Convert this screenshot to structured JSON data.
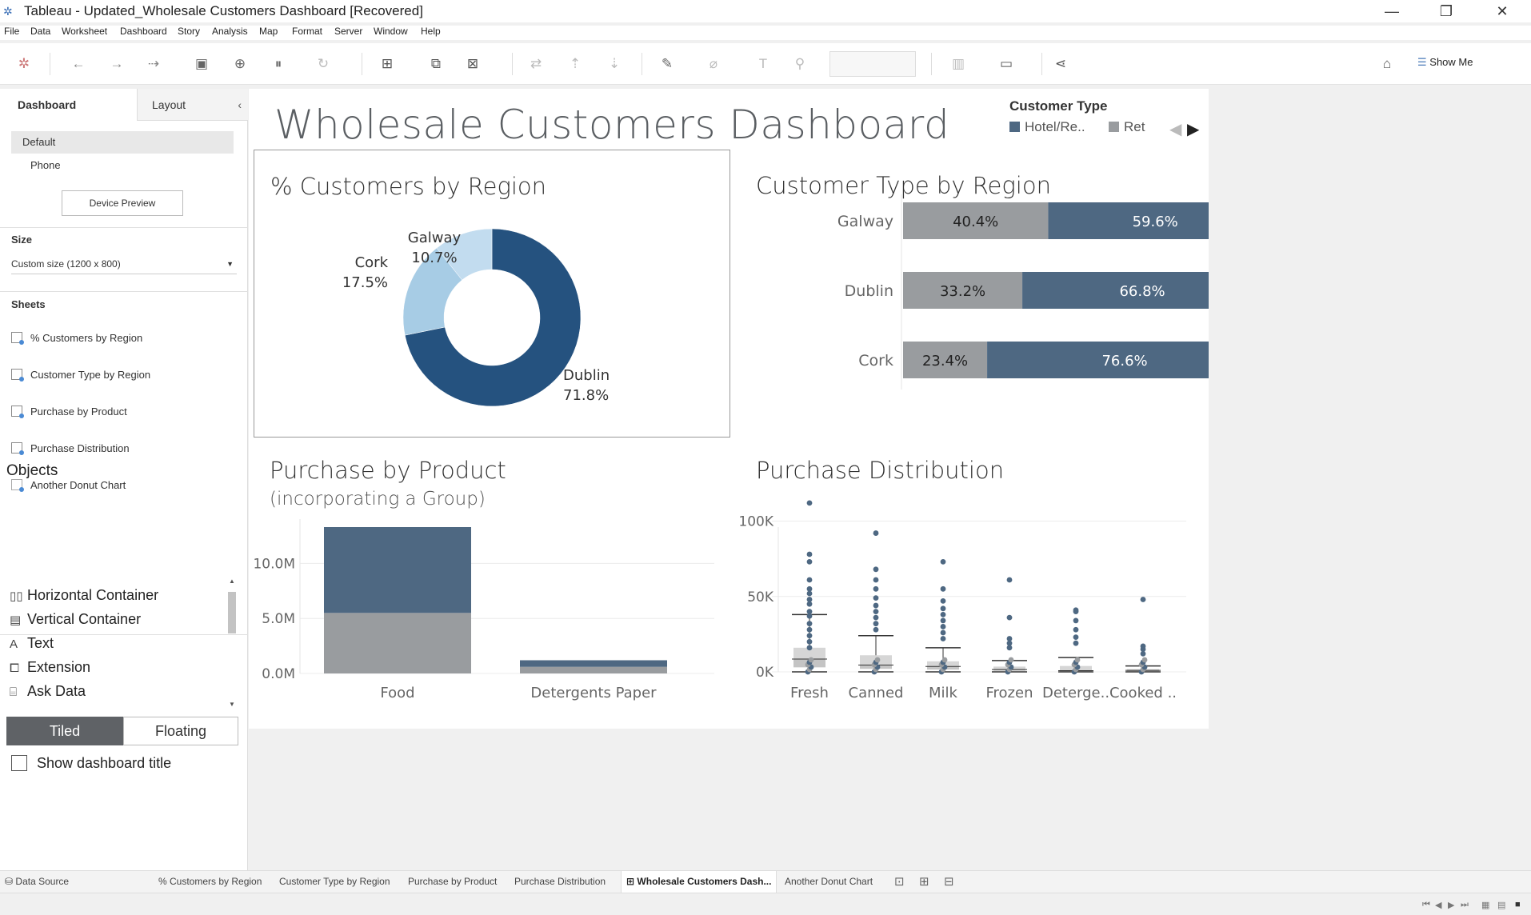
{
  "window": {
    "title": "Tableau - Updated_Wholesale Customers Dashboard [Recovered]"
  },
  "menu": [
    "File",
    "Data",
    "Worksheet",
    "Dashboard",
    "Story",
    "Analysis",
    "Map",
    "Format",
    "Server",
    "Window",
    "Help"
  ],
  "toolbar": {
    "show_me": "Show Me"
  },
  "left_panel": {
    "tabs": {
      "dashboard": "Dashboard",
      "layout": "Layout"
    },
    "devices": {
      "default": "Default",
      "phone": "Phone",
      "preview_button": "Device Preview"
    },
    "size": {
      "label": "Size",
      "value": "Custom size (1200 x 800)"
    },
    "sheets": {
      "label": "Sheets",
      "items": [
        "% Customers by Region",
        "Customer Type by Region",
        "Purchase by Product",
        "Purchase Distribution",
        "Another Donut Chart"
      ]
    },
    "objects": {
      "label": "Objects",
      "items": [
        "Horizontal Container",
        "Vertical Container",
        "Text",
        "Extension",
        "Ask Data"
      ]
    },
    "mode": {
      "tiled": "Tiled",
      "floating": "Floating"
    },
    "show_title": "Show dashboard title"
  },
  "dashboard": {
    "title": "Wholesale Customers Dashboard",
    "legend": {
      "title": "Customer Type",
      "items": [
        "Hotel/Re..",
        "Ret"
      ]
    }
  },
  "colors": {
    "hotel": "#4e6882",
    "retail": "#999c9f",
    "dublin": "#25527f",
    "cork": "#a7cce5",
    "galway": "#c2dcef"
  },
  "chart_data": [
    {
      "type": "pie",
      "title": "% Customers by Region",
      "slices": [
        {
          "label": "Dublin",
          "value": 71.8,
          "text": "71.8%"
        },
        {
          "label": "Cork",
          "value": 17.5,
          "text": "17.5%"
        },
        {
          "label": "Galway",
          "value": 10.7,
          "text": "10.7%"
        }
      ]
    },
    {
      "type": "bar",
      "title": "Customer Type by Region",
      "categories": [
        "Galway",
        "Dublin",
        "Cork"
      ],
      "series": [
        {
          "name": "Ret",
          "values": [
            40.4,
            33.2,
            23.4
          ],
          "labels": [
            "40.4%",
            "33.2%",
            "23.4%"
          ]
        },
        {
          "name": "Hotel/Re..",
          "values": [
            59.6,
            66.8,
            76.6
          ],
          "labels": [
            "59.6%",
            "66.8%",
            "76.6%"
          ]
        }
      ]
    },
    {
      "type": "bar",
      "title": "Purchase by Product",
      "subtitle": "(incorporating a Group)",
      "categories": [
        "Food",
        "Detergents Paper"
      ],
      "yticks": [
        "0.0M",
        "5.0M",
        "10.0M"
      ],
      "ylim": [
        0,
        13.3
      ],
      "series": [
        {
          "name": "Ret",
          "values": [
            5.5,
            0.6
          ]
        },
        {
          "name": "Hotel/Re..",
          "values": [
            7.8,
            0.6
          ]
        }
      ]
    },
    {
      "type": "scatter",
      "title": "Purchase Distribution",
      "categories": [
        "Fresh",
        "Canned",
        "Milk",
        "Frozen",
        "Deterge..",
        "Cooked .."
      ],
      "yticks": [
        "0K",
        "50K",
        "100K"
      ],
      "ylim": [
        0,
        113000
      ],
      "outliers": [
        [
          112000,
          78000,
          73000,
          61000,
          55000,
          52000,
          48000,
          45000,
          40000,
          37000,
          32000,
          28000,
          24000,
          20000,
          16000
        ],
        [
          92000,
          68000,
          61000,
          55000,
          49000,
          44000,
          40000,
          36000,
          32000,
          28000
        ],
        [
          73000,
          55000,
          47000,
          42000,
          38000,
          34000,
          30000,
          26000,
          22000
        ],
        [
          61000,
          36000,
          22000,
          19000,
          16000
        ],
        [
          41000,
          40000,
          34000,
          28000,
          23000,
          19000
        ],
        [
          48000,
          17000,
          15000,
          12000
        ]
      ],
      "boxes": [
        {
          "min": 0,
          "q1": 3000,
          "median": 8500,
          "q3": 16000,
          "max": 38000
        },
        {
          "min": 0,
          "q1": 2000,
          "median": 4500,
          "q3": 11000,
          "max": 24000
        },
        {
          "min": 0,
          "q1": 1500,
          "median": 3600,
          "q3": 7000,
          "max": 16000
        },
        {
          "min": 0,
          "q1": 750,
          "median": 1500,
          "q3": 3500,
          "max": 7500
        },
        {
          "min": 0,
          "q1": 250,
          "median": 800,
          "q3": 3900,
          "max": 9500
        },
        {
          "min": 0,
          "q1": 400,
          "median": 1000,
          "q3": 1800,
          "max": 3900
        }
      ]
    }
  ],
  "bottom_tabs": {
    "data_source": "Data Source",
    "sheets": [
      "% Customers by Region",
      "Customer Type by Region",
      "Purchase by Product",
      "Purchase Distribution",
      "Wholesale Customers Dash...",
      "Another Donut Chart"
    ],
    "active_index": 4
  }
}
